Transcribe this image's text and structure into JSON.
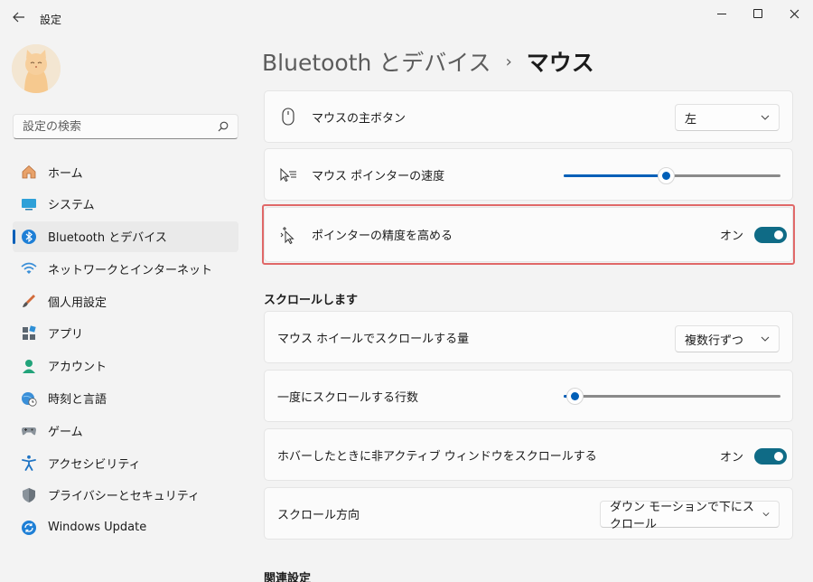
{
  "window": {
    "title": "設定",
    "back_icon": "back-arrow-icon",
    "controls": [
      "minimize",
      "maximize",
      "close"
    ]
  },
  "sidebar": {
    "search_placeholder": "設定の検索",
    "items": [
      {
        "label": "ホーム",
        "icon": "home-icon",
        "active": false
      },
      {
        "label": "システム",
        "icon": "system-icon",
        "active": false
      },
      {
        "label": "Bluetooth とデバイス",
        "icon": "bluetooth-icon",
        "active": true
      },
      {
        "label": "ネットワークとインターネット",
        "icon": "wifi-icon",
        "active": false
      },
      {
        "label": "個人用設定",
        "icon": "brush-icon",
        "active": false
      },
      {
        "label": "アプリ",
        "icon": "apps-icon",
        "active": false
      },
      {
        "label": "アカウント",
        "icon": "account-icon",
        "active": false
      },
      {
        "label": "時刻と言語",
        "icon": "globe-clock-icon",
        "active": false
      },
      {
        "label": "ゲーム",
        "icon": "gamepad-icon",
        "active": false
      },
      {
        "label": "アクセシビリティ",
        "icon": "accessibility-icon",
        "active": false
      },
      {
        "label": "プライバシーとセキュリティ",
        "icon": "shield-icon",
        "active": false
      },
      {
        "label": "Windows Update",
        "icon": "windows-update-icon",
        "active": false
      }
    ]
  },
  "breadcrumb": {
    "parent": "Bluetooth とデバイス",
    "separator": "›",
    "current": "マウス"
  },
  "settings": {
    "primary_button": {
      "label": "マウスの主ボタン",
      "value": "左"
    },
    "pointer_speed": {
      "label": "マウス ポインターの速度",
      "value_fraction": 0.47
    },
    "enhance_precision": {
      "label": "ポインターの精度を高める",
      "state": "オン"
    }
  },
  "scroll_section": {
    "title": "スクロールします",
    "wheel_amount": {
      "label": "マウス ホイールでスクロールする量",
      "value": "複数行ずつ"
    },
    "lines_per_scroll": {
      "label": "一度にスクロールする行数",
      "value_fraction": 0.05
    },
    "inactive_scroll": {
      "label": "ホバーしたときに非アクティブ ウィンドウをスクロールする",
      "state": "オン"
    },
    "scroll_direction": {
      "label": "スクロール方向",
      "value": "ダウン モーションで下にスクロール"
    }
  },
  "related_section": {
    "title": "関連設定"
  },
  "colors": {
    "accent": "#005fb8",
    "toggle_on": "#0f6b86",
    "highlight": "#e06868"
  }
}
